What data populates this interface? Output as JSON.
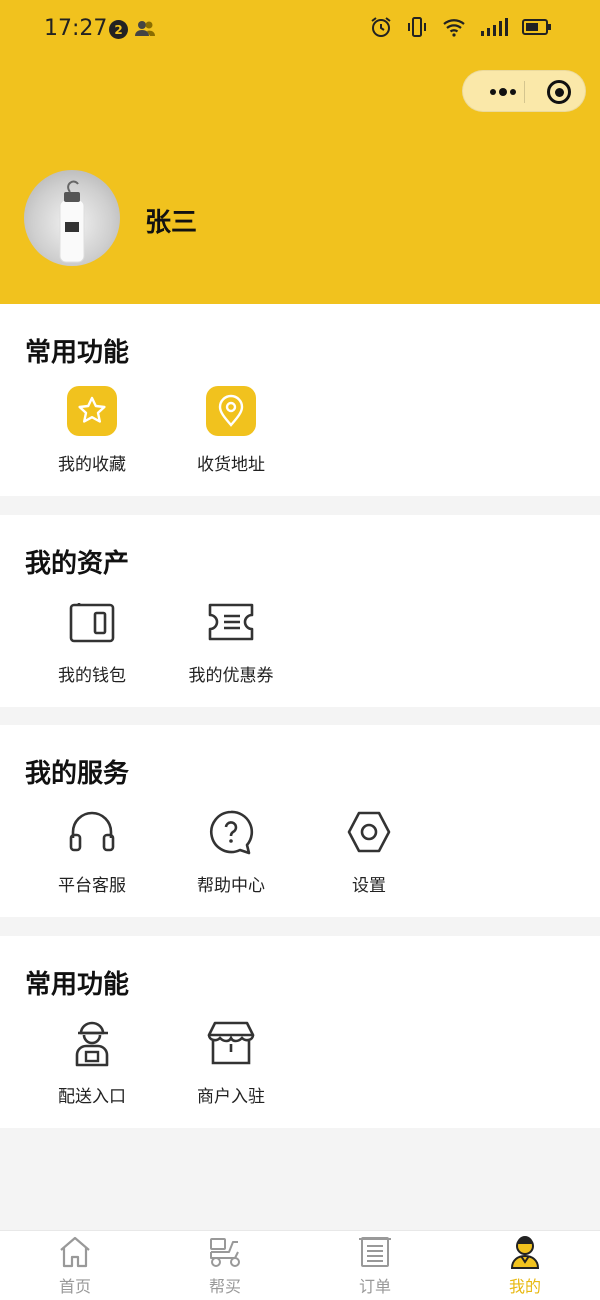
{
  "status_bar": {
    "time": "17:27",
    "badge": "2"
  },
  "profile": {
    "username": "张三"
  },
  "sections": [
    {
      "title": "常用功能",
      "items": [
        {
          "label": "我的收藏",
          "icon": "star-icon"
        },
        {
          "label": "收货地址",
          "icon": "location-pin-icon"
        }
      ]
    },
    {
      "title": "我的资产",
      "items": [
        {
          "label": "我的钱包",
          "icon": "wallet-icon"
        },
        {
          "label": "我的优惠券",
          "icon": "coupon-icon"
        }
      ]
    },
    {
      "title": "我的服务",
      "items": [
        {
          "label": "平台客服",
          "icon": "headphones-icon"
        },
        {
          "label": "帮助中心",
          "icon": "help-bubble-icon"
        },
        {
          "label": "设置",
          "icon": "gear-icon"
        }
      ]
    },
    {
      "title": "常用功能",
      "items": [
        {
          "label": "配送入口",
          "icon": "courier-icon"
        },
        {
          "label": "商户入驻",
          "icon": "shop-icon"
        }
      ]
    }
  ],
  "tabbar": {
    "items": [
      {
        "label": "首页",
        "icon": "home-icon"
      },
      {
        "label": "帮买",
        "icon": "scooter-icon"
      },
      {
        "label": "订单",
        "icon": "receipt-icon"
      },
      {
        "label": "我的",
        "icon": "user-icon",
        "active": true
      }
    ]
  },
  "colors": {
    "accent": "#f1c21e",
    "active_tab": "#e8b913",
    "icon_stroke": "#333333"
  }
}
